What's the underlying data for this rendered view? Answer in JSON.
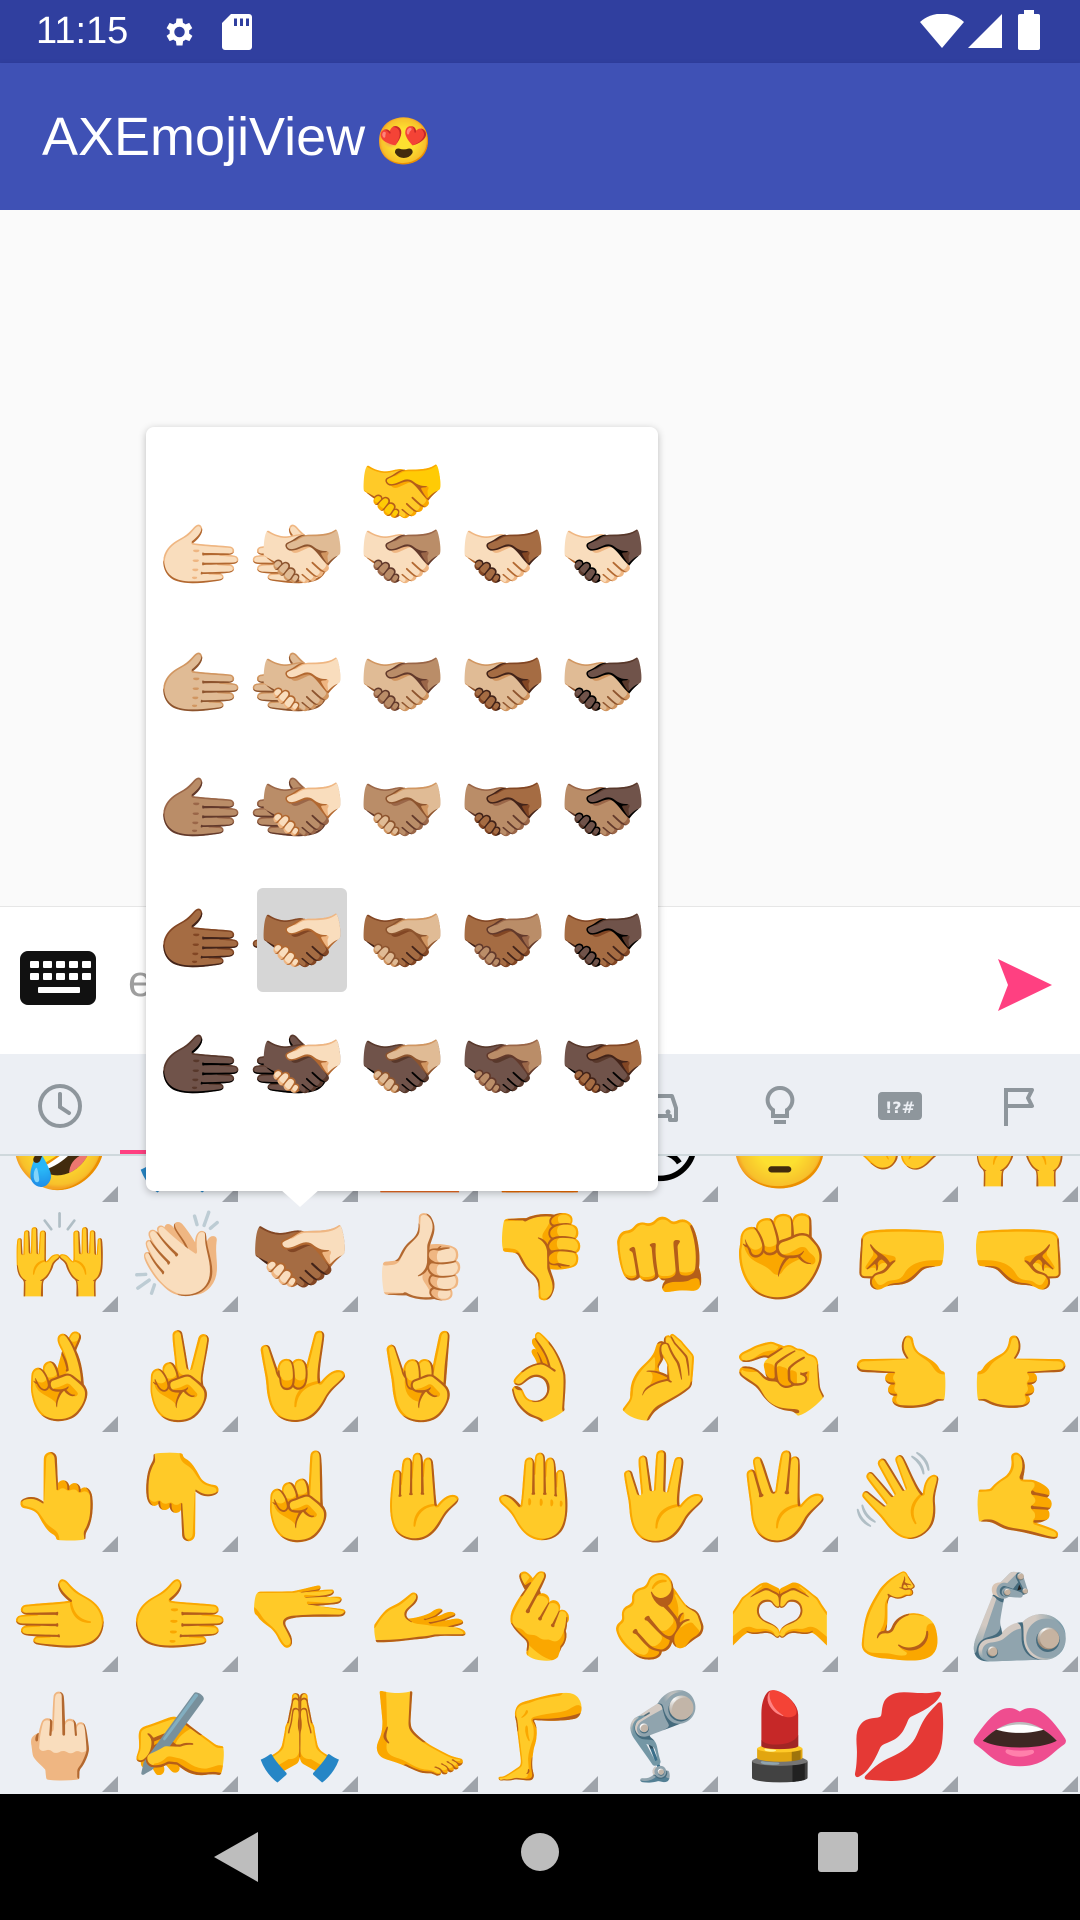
{
  "status": {
    "time": "11:15"
  },
  "app": {
    "title": "AXEmojiView",
    "title_emoji": "😍"
  },
  "input": {
    "placeholder": "e"
  },
  "tabs": [
    "recent",
    "smileys",
    "people",
    "animals",
    "food",
    "travel",
    "objects",
    "symbols",
    "flags"
  ],
  "popup": {
    "base": "🤝",
    "rows": [
      [
        "🫱🏻‍🫲🏻",
        "🫱🏻‍🫲🏼",
        "🫱🏻‍🫲🏽",
        "🫱🏻‍🫲🏾",
        "🫱🏻‍🫲🏿"
      ],
      [
        "🫱🏼‍🫲🏼",
        "🫱🏼‍🫲🏻",
        "🫱🏼‍🫲🏽",
        "🫱🏼‍🫲🏾",
        "🫱🏼‍🫲🏿"
      ],
      [
        "🫱🏽‍🫲🏽",
        "🫱🏽‍🫲🏻",
        "🫱🏽‍🫲🏼",
        "🫱🏽‍🫲🏾",
        "🫱🏽‍🫲🏿"
      ],
      [
        "🫱🏾‍🫲🏾",
        "🫱🏾‍🫲🏻",
        "🫱🏾‍🫲🏼",
        "🫱🏾‍🫲🏽",
        "🫱🏾‍🫲🏿"
      ],
      [
        "🫱🏿‍🫲🏿",
        "🫱🏿‍🫲🏻",
        "🫱🏿‍🫲🏼",
        "🫱🏿‍🫲🏽",
        "🫱🏿‍🫲🏾"
      ]
    ],
    "selected": "🫱🏾‍🫲🏻"
  },
  "grid": {
    "rows": [
      [
        "🤣",
        "🙏",
        "🤲",
        "🙋",
        "🙆",
        "😣",
        "🙄",
        "👐",
        "🙌"
      ],
      [
        "🙌",
        "👏🏻",
        "🫱🏾‍🫲🏻",
        "👍🏻",
        "👎",
        "👊",
        "✊",
        "🤛",
        "🤜"
      ],
      [
        "🤞",
        "✌️",
        "🤟",
        "🤘",
        "👌",
        "🤌",
        "🤏",
        "👈",
        "👉"
      ],
      [
        "👆",
        "👇",
        "☝️",
        "✋",
        "🤚",
        "🖐️",
        "🖖",
        "👋",
        "🤙"
      ],
      [
        "🫲",
        "🫱",
        "🫳",
        "🫴",
        "🫰",
        "🫵",
        "🫶",
        "💪",
        "🦾"
      ],
      [
        "🖕🏻",
        "✍️",
        "🙏",
        "🦶",
        "🦵",
        "🦿",
        "💄",
        "💋",
        "👄"
      ]
    ]
  },
  "colors": {
    "status_bar": "#303f9f",
    "app_bar": "#3f51b5",
    "accent": "#ff4081",
    "panel": "#eceff4"
  }
}
